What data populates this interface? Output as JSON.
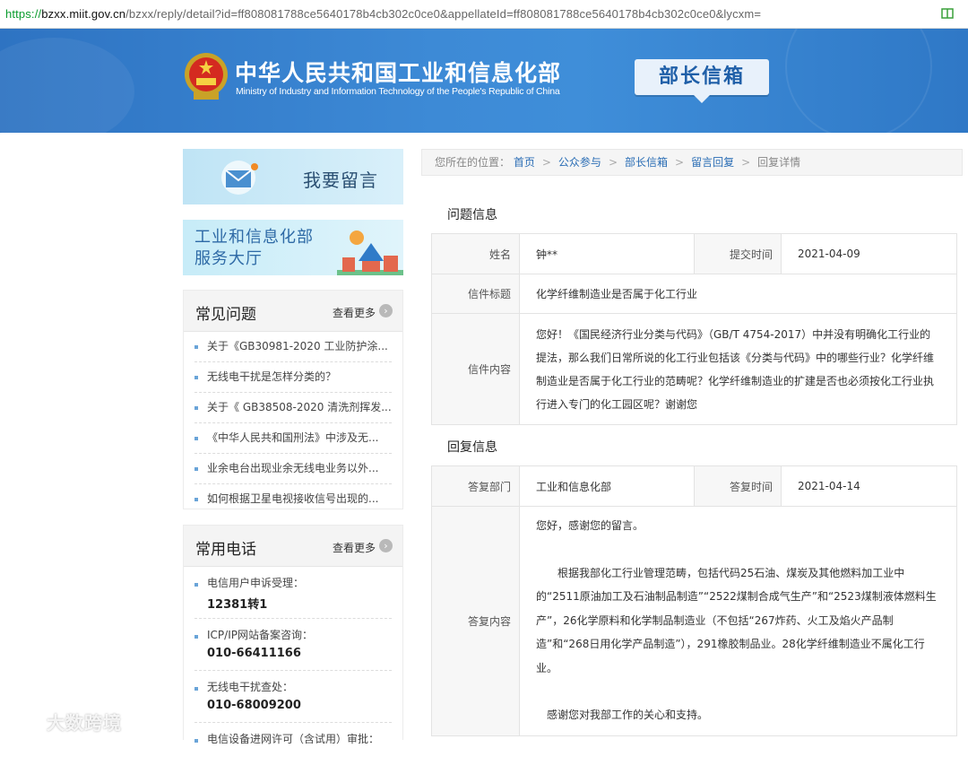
{
  "browser": {
    "url_scheme": "https://",
    "url_host": "bzxx.miit.gov.cn",
    "url_rest": "/bzxx/reply/detail?id=ff808081788ce5640178b4cb302c0ce0&appellateId=ff808081788ce5640178b4cb302c0ce0&lycxm=",
    "reader_icon": "book-icon"
  },
  "header": {
    "emblem_icon": "national-emblem-icon",
    "title_cn": "中华人民共和国工业和信息化部",
    "title_en": "Ministry of Industry and Information Technology of the People's Republic of China",
    "mailbox_label": "部长信箱"
  },
  "sidebar": {
    "leave_message": "我要留言",
    "service_hall_line1": "工业和信息化部",
    "service_hall_line2": "服务大厅",
    "faq": {
      "title": "常见问题",
      "more": "查看更多",
      "items": [
        "关于《GB30981-2020 工业防护涂...",
        "无线电干扰是怎样分类的？",
        "关于《 GB38508-2020 清洗剂挥发...",
        "《中华人民共和国刑法》中涉及无...",
        "业余电台出现业余无线电业务以外...",
        "如何根据卫星电视接收信号出现的..."
      ]
    },
    "phones": {
      "title": "常用电话",
      "more": "查看更多",
      "items": [
        {
          "label": "电信用户申诉受理：",
          "number": "12381转1"
        },
        {
          "label": "ICP/IP网站备案咨询：",
          "number": "010-66411166"
        },
        {
          "label": "无线电干扰查处：",
          "number": "010-68009200"
        },
        {
          "label": "电信设备进网许可（含试用）审批：",
          "number": ""
        }
      ]
    }
  },
  "breadcrumb": {
    "prefix": "您所在的位置：",
    "links": [
      "首页",
      "公众参与",
      "部长信箱",
      "留言回复"
    ],
    "current": "回复详情",
    "separator": ">"
  },
  "question": {
    "section_title": "问题信息",
    "name_label": "姓名",
    "name_value": "钟**",
    "time_label": "提交时间",
    "time_value": "2021-04-09",
    "subject_label": "信件标题",
    "subject_value": "化学纤维制造业是否属于化工行业",
    "content_label": "信件内容",
    "content_value": "您好！《国民经济行业分类与代码》（GB/T 4754-2017）中并没有明确化工行业的提法，那么我们日常所说的化工行业包括该《分类与代码》中的哪些行业？化学纤维制造业是否属于化工行业的范畴呢？化学纤维制造业的扩建是否也必须按化工行业执行进入专门的化工园区呢？谢谢您"
  },
  "reply": {
    "section_title": "回复信息",
    "dept_label": "答复部门",
    "dept_value": "工业和信息化部",
    "time_label": "答复时间",
    "time_value": "2021-04-14",
    "content_label": "答复内容",
    "greeting": "您好，感谢您的留言。",
    "body": "根据我部化工行业管理范畴，包括代码25石油、煤炭及其他燃料加工业中的“2511原油加工及石油制品制造”“2522煤制合成气生产”和“2523煤制液体燃料生产”，26化学原料和化学制品制造业（不包括“267炸药、火工及焰火产品制造”和“268日用化学产品制造”），291橡胶制品业。28化学纤维制造业不属化工行业。",
    "closing": "感谢您对我部工作的关心和支持。"
  },
  "watermark": {
    "text": "大数跨境"
  },
  "colors": {
    "banner_blue": "#3d8ad6",
    "link_blue": "#2a6db5",
    "url_green": "#0a9c2e"
  }
}
